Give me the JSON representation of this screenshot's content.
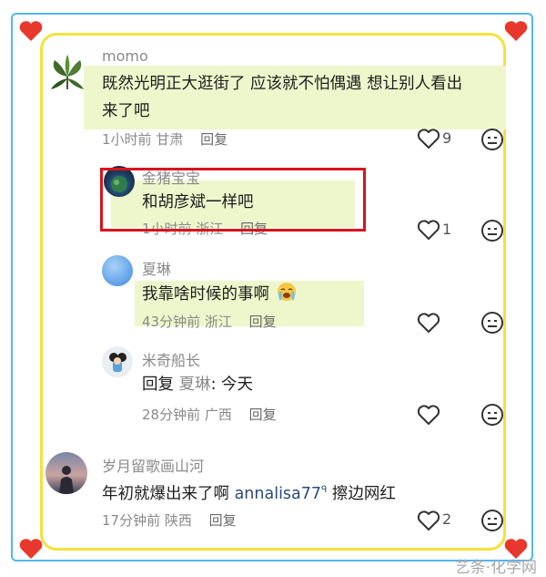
{
  "comments": [
    {
      "user": "momo",
      "text_line1": "既然光明正大逛街了 应该就不怕偶遇 想让别人看出",
      "text_line2": "来了吧",
      "time": "1小时前",
      "location": "甘肃",
      "reply_label": "回复",
      "likes": "9"
    },
    {
      "user": "金猪宝宝",
      "text": "和胡彦斌一样吧",
      "time": "1小时前",
      "location": "浙江",
      "reply_label": "回复",
      "likes": "1"
    },
    {
      "user": "夏琳",
      "text": "我靠啥时候的事啊",
      "time": "43分钟前",
      "location": "浙江",
      "reply_label": "回复",
      "likes": ""
    },
    {
      "user": "米奇船长",
      "reply_prefix": "回复",
      "reply_to": "夏琳",
      "text": ": 今天",
      "time": "28分钟前",
      "location": "广西",
      "reply_label": "回复",
      "likes": ""
    },
    {
      "user": "岁月留歌画山河",
      "text_a": "年初就爆出来了啊",
      "mention": "annalisa77",
      "mention_sup": "ᑫ",
      "text_b": "擦边网红",
      "time": "17分钟前",
      "location": "陕西",
      "reply_label": "回复",
      "likes": "2"
    }
  ],
  "watermark": "艺条·化学网",
  "colors": {
    "highlight": "#eef7cc",
    "red_box": "#d8141e",
    "frame_blue": "#52b7f2",
    "frame_yellow": "#f5e23b",
    "heart": "#e8372c"
  }
}
